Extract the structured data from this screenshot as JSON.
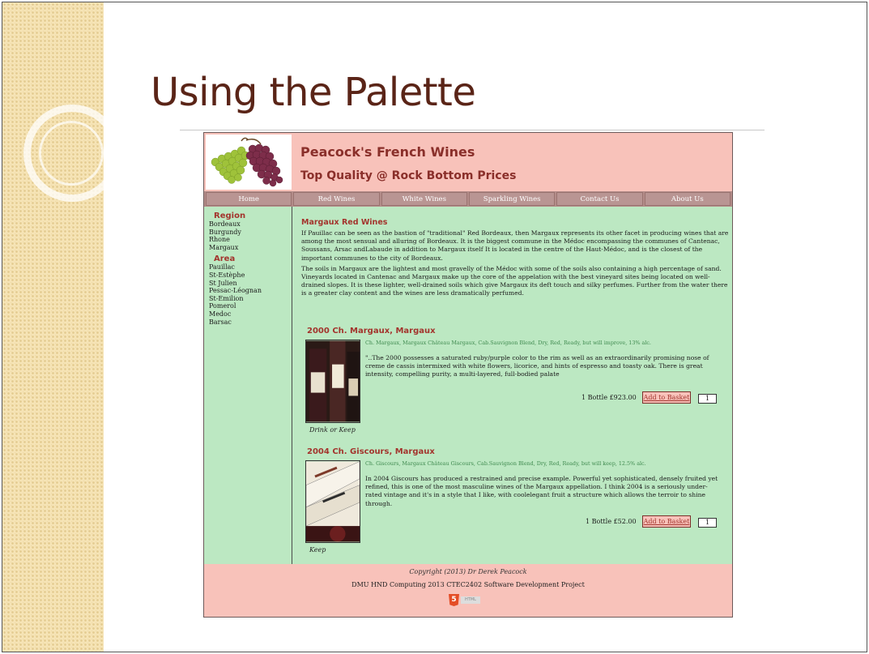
{
  "slide": {
    "title": "Using the Palette"
  },
  "site": {
    "name": "Peacock's French Wines",
    "tagline": "Top Quality @ Rock Bottom Prices",
    "nav": [
      "Home",
      "Red Wines",
      "White Wines",
      "Sparkling Wines",
      "Contact Us",
      "About Us"
    ],
    "region_heading": "Region",
    "regions": [
      "Bordeaux",
      "Burgundy",
      "Rhone",
      "Margaux"
    ],
    "area_heading": "Area",
    "areas": [
      "Pauillac",
      "St-Estèphe",
      "St Julien",
      "Pessac-Léognan",
      "St-Emilion",
      "Pomerol",
      "Medoc",
      "Barsac"
    ],
    "main_heading": "Margaux Red Wines",
    "paragraphs": [
      "If Pauillac can be seen as the bastion of \"traditional\" Red Bordeaux, then Margaux represents its other facet in producing wines that are among the most sensual and alluring of Bordeaux. It is the biggest commune in the Médoc encompassing the communes of Cantenac, Soussans, Arsac andLabaude in addition to Margaux itself It is located in the centre of the Haut-Médoc, and is the closest of the important communes to the city of Bordeaux.",
      "The soils in Margaux are the lightest and most gravelly of the Médoc with some of the soils also containing a high percentage of sand. Vineyards located in Cantenac and Margaux make up the core of the appelation with the best vineyard sites being located on well-drained slopes. It is these lighter, well-drained soils which give Margaux its deft touch and silky perfumes. Further from the water there is a greater clay content and the wines are less dramatically perfumed."
    ],
    "products": [
      {
        "title": "2000 Ch. Margaux, Margaux",
        "spec": "Ch. Margaux, Margaux Château Margaux, Cab.Sauvignon Blend, Dry, Red, Ready, but will improve, 13% alc.",
        "description": "\"..The 2000 possesses a saturated ruby/purple color to the rim as well as an extraordinarily promising nose of creme de cassis intermixed with white flowers, licorice, and hints of espresso and toasty oak. There is great intensity, compelling purity, a multi-layered, full-bodied palate",
        "price": "1 Bottle £923.00",
        "button": "Add to Basket",
        "qty": "1",
        "caption": "Drink or Keep"
      },
      {
        "title": "2004 Ch. Giscours, Margaux",
        "spec": "Ch. Giscours, Margaux Château Giscours, Cab.Sauvignon Blend, Dry, Red, Ready, but will keep, 12.5% alc.",
        "description": "In 2004 Giscours has produced a restrained and precise example. Powerful yet sophisticated, densely fruited yet refined, this is one of the most masculine wines of the Margaux appellation. I think 2004 is a seriously under-rated vintage and it's in a style that I like, with coolelegant fruit a structure which allows the terroir to shine through.",
        "price": "1 Bottle £52.00",
        "button": "Add to Basket",
        "qty": "1",
        "caption": "Keep"
      }
    ],
    "footer": {
      "copyright": "Copyright (2013) Dr Derek Peacock",
      "project": "DMU HND Computing 2013 CTEC2402 Software Development Project",
      "badge": "5",
      "badge_tag": "HTML"
    }
  },
  "colors": {
    "title": "#5a2417",
    "header_bg": "#f8c2ba",
    "body_bg": "#bce8c2",
    "accent": "#a3342d",
    "nav_bg": "#b99593"
  }
}
